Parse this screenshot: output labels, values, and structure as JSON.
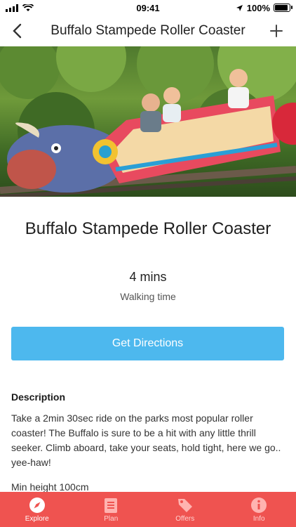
{
  "status": {
    "time": "09:41",
    "battery": "100%"
  },
  "nav": {
    "title": "Buffalo Stampede Roller Coaster"
  },
  "hero": {
    "image_icon": "roller-coaster-photo"
  },
  "ride": {
    "title": "Buffalo Stampede Roller Coaster",
    "walk_value": "4 mins",
    "walk_label": "Walking time",
    "directions_label": "Get Directions",
    "description_heading": "Description",
    "description": "Take a 2min 30sec ride on the parks most popular roller coaster! The Buffalo is sure to be a hit with any little thrill seeker. Climb aboard, take your seats, hold tight, here we go.. yee-haw!",
    "min_height": "Min height 100cm"
  },
  "tabs": [
    {
      "label": "Explore",
      "icon": "compass-icon",
      "active": true
    },
    {
      "label": "Plan",
      "icon": "checklist-icon",
      "active": false
    },
    {
      "label": "Offers",
      "icon": "tag-icon",
      "active": false
    },
    {
      "label": "Info",
      "icon": "info-icon",
      "active": false
    }
  ],
  "colors": {
    "accent": "#4db8ee",
    "tab_bar": "#ef5350"
  }
}
